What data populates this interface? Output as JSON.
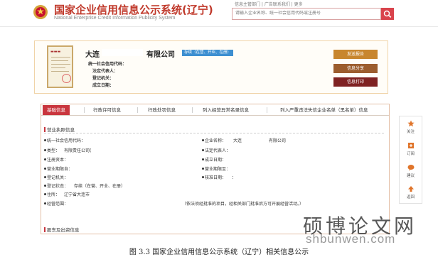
{
  "header": {
    "title": "国家企业信用信息公示系统(辽宁)",
    "subtitle": "National Enterprise Credit Information Publicity System",
    "top_links": "信息主管部门    |    广告联系我们    |    更多",
    "search_placeholder": "请输入企业名称、统一社会信用代码或注册号"
  },
  "company": {
    "name_prefix": "大连",
    "name_suffix": "有限公司",
    "status_badge": "存续（在营、开业、在册）",
    "fields": [
      {
        "label": "统一社会信用代码："
      },
      {
        "label": "法定代表人："
      },
      {
        "label": "登记机关："
      },
      {
        "label": "成立日期："
      }
    ]
  },
  "actions": {
    "send_report": "发送报告",
    "share_info": "信息分享",
    "print_info": "信息打印"
  },
  "tabs": [
    {
      "label": "基础信息",
      "active": true
    },
    {
      "label": "行政许可信息",
      "active": false
    },
    {
      "label": "行政处罚信息",
      "active": false
    },
    {
      "label": "列入经营异常名录信息",
      "active": false
    },
    {
      "label": "列入严重违法失信企业名单（黑名单）信息",
      "active": false
    }
  ],
  "business_license": {
    "section_title": "营业执照信息",
    "left_fields": [
      {
        "label": "统一社会信用代码：",
        "value": ""
      },
      {
        "label": "类型：",
        "value": "有限责任公司("
      },
      {
        "label": "注册资本：",
        "value": ""
      },
      {
        "label": "营业期限自：",
        "value": ""
      },
      {
        "label": "登记机关：",
        "value": ""
      },
      {
        "label": "登记状态：",
        "value": "存续（在营、开业、在册）"
      },
      {
        "label": "住所：",
        "value": "辽宁省大连市"
      }
    ],
    "right_fields": [
      {
        "label": "企业名称：",
        "value": "大连"
      },
      {
        "label": "法定代表人：",
        "value": ""
      },
      {
        "label": "成立日期：",
        "value": ""
      },
      {
        "label": "营业期限至：",
        "value": ""
      },
      {
        "label": "核准日期：",
        "value": "："
      }
    ],
    "company_name_tail": "有限公司",
    "scope_label": "经营范围：",
    "scope_note": "（依法须经批准的项目，经相关部门批准后方可开展经营活动。）"
  },
  "shareholders": {
    "section_title": "股东及出资信息"
  },
  "sidebar": [
    {
      "label": "关注",
      "icon": "star-icon"
    },
    {
      "label": "订阅",
      "icon": "subscribe-icon"
    },
    {
      "label": "建议",
      "icon": "message-icon"
    },
    {
      "label": "返回",
      "icon": "back-top-icon"
    }
  ],
  "watermark": {
    "text": "硕博论文网",
    "url": "shbunwen.com"
  },
  "caption": "图 3.3 国家企业信用信息公示系统（辽宁）相关信息公示",
  "colors": {
    "brand_red": "#c0392b",
    "active_tab": "#c9363e",
    "badge_blue": "#3d8fd1",
    "btn_orange": "#c8862e",
    "btn_brown": "#9c5d2e",
    "btn_red": "#7f2222"
  }
}
